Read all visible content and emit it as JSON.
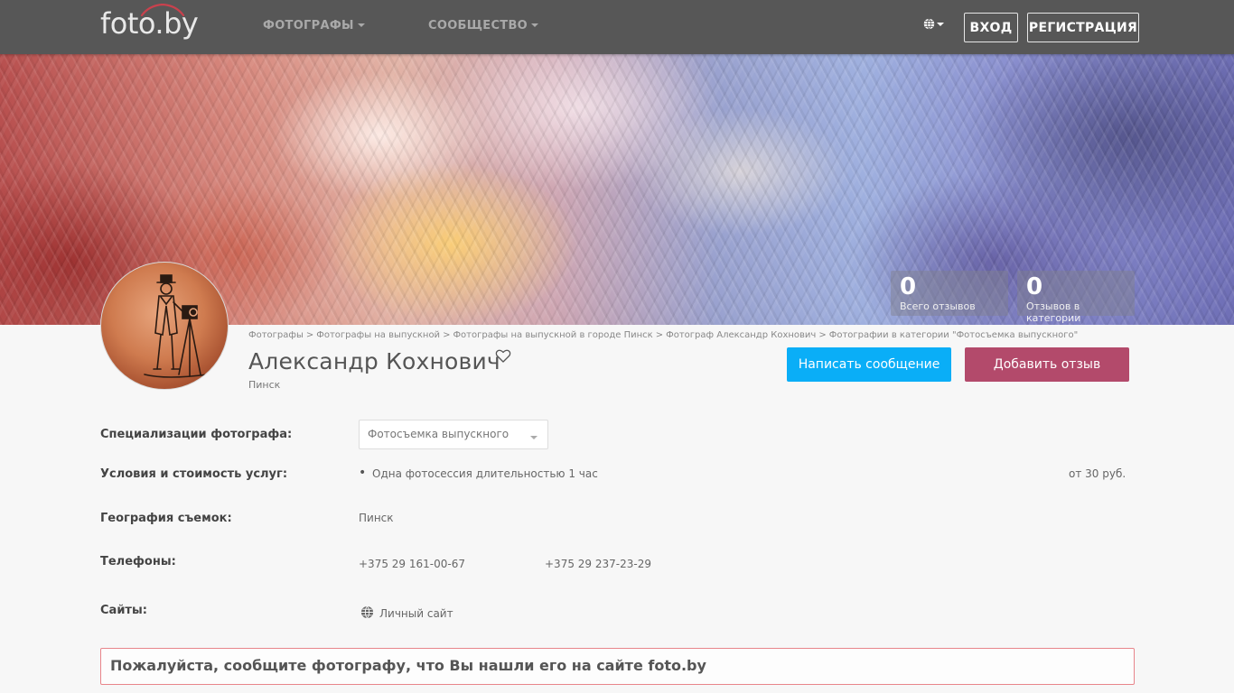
{
  "brand": {
    "logo_text": "foto.by"
  },
  "navbar": {
    "menu": [
      {
        "label": "ФОТОГРАФЫ"
      },
      {
        "label": "СООБЩЕСТВО"
      }
    ],
    "login_label": "ВХОД",
    "register_label": "РЕГИСТРАЦИЯ"
  },
  "stats": {
    "total_reviews": {
      "value": "0",
      "label": "Всего отзывов"
    },
    "category_reviews": {
      "value": "0",
      "label": "Отзывов в категории"
    }
  },
  "breadcrumbs": [
    "Фотографы",
    "Фотографы на выпускной",
    "Фотографы на выпускной в городе Пинск",
    "Фотограф Александр Кохнович",
    "Фотографии в категории \"Фотосъемка выпускного\""
  ],
  "breadcrumb_separator": ">",
  "profile": {
    "name": "Александр Кохнович",
    "city": "Пинск",
    "message_button": "Написать сообщение",
    "review_button": "Добавить отзыв"
  },
  "details": {
    "specializations": {
      "label": "Специализации фотографа:",
      "selected": "Фотосъемка выпускного"
    },
    "services": {
      "label": "Условия и стоимость услуг:",
      "item": "Одна фотосессия длительностью 1 час",
      "price": "от 30 руб."
    },
    "geography": {
      "label": "География съемок:",
      "value": "Пинск"
    },
    "phones": {
      "label": "Телефоны:",
      "items": [
        "+375 29 161-00-67",
        "+375 29 237-23-29"
      ]
    },
    "sites": {
      "label": "Сайты:",
      "link": "Личный сайт"
    }
  },
  "notice": "Пожалуйста, сообщите фотографу, что Вы нашли его на сайте foto.by",
  "colors": {
    "navbar": "#575757",
    "message_button": "#0aaef7",
    "review_button": "#b34a6b",
    "notice_border": "#e8858b"
  },
  "icons": [
    "globe-icon",
    "heart-icon",
    "caret-down-icon"
  ]
}
